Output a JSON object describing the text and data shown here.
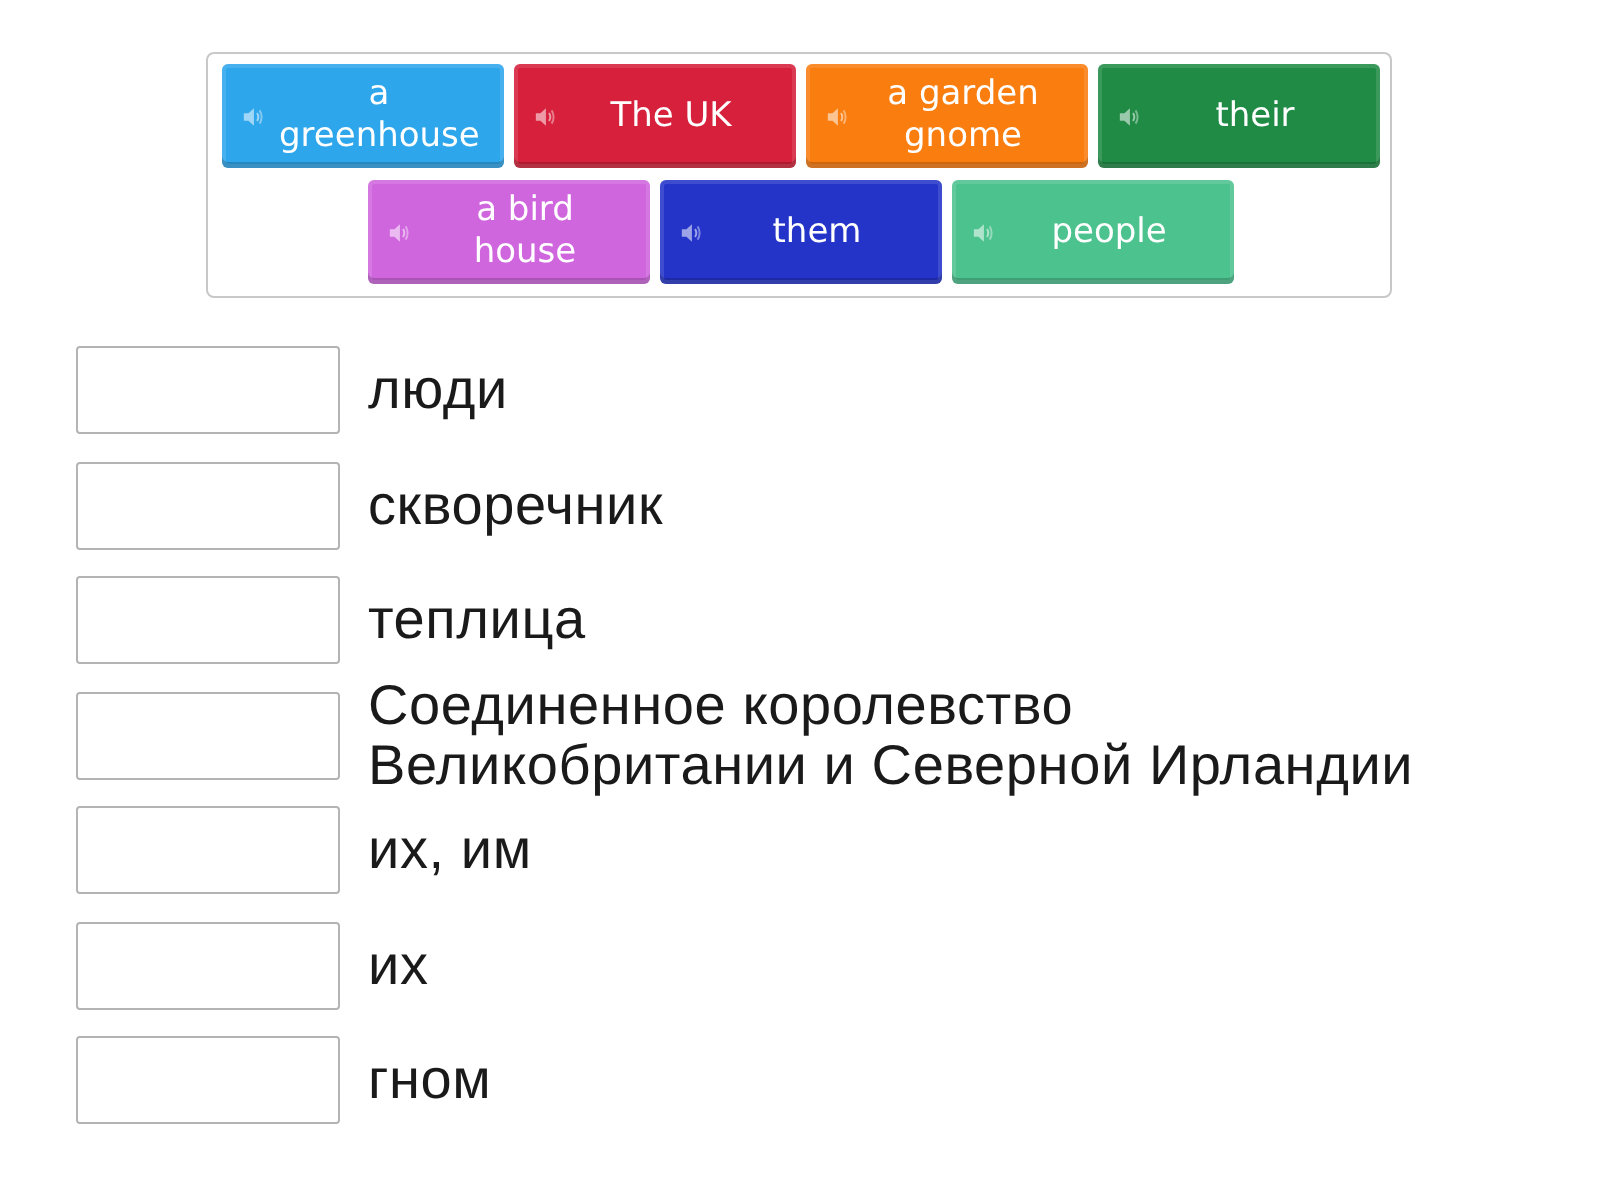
{
  "tiles": [
    {
      "label": "a greenhouse",
      "color": "#2ea6ec"
    },
    {
      "label": "The UK",
      "color": "#d7203b"
    },
    {
      "label": "a garden gnome",
      "color": "#fa7d10"
    },
    {
      "label": "their",
      "color": "#1f8b45"
    },
    {
      "label": "a bird house",
      "color": "#d066de"
    },
    {
      "label": "them",
      "color": "#2434c9"
    },
    {
      "label": "people",
      "color": "#4cc28e"
    }
  ],
  "answers": [
    {
      "text": "люди"
    },
    {
      "text": "скворечник"
    },
    {
      "text": "теплица"
    },
    {
      "text": "Соединенное королевство Великобритании и Северной Ирландии"
    },
    {
      "text": "их, им"
    },
    {
      "text": "их"
    },
    {
      "text": "гном"
    }
  ]
}
